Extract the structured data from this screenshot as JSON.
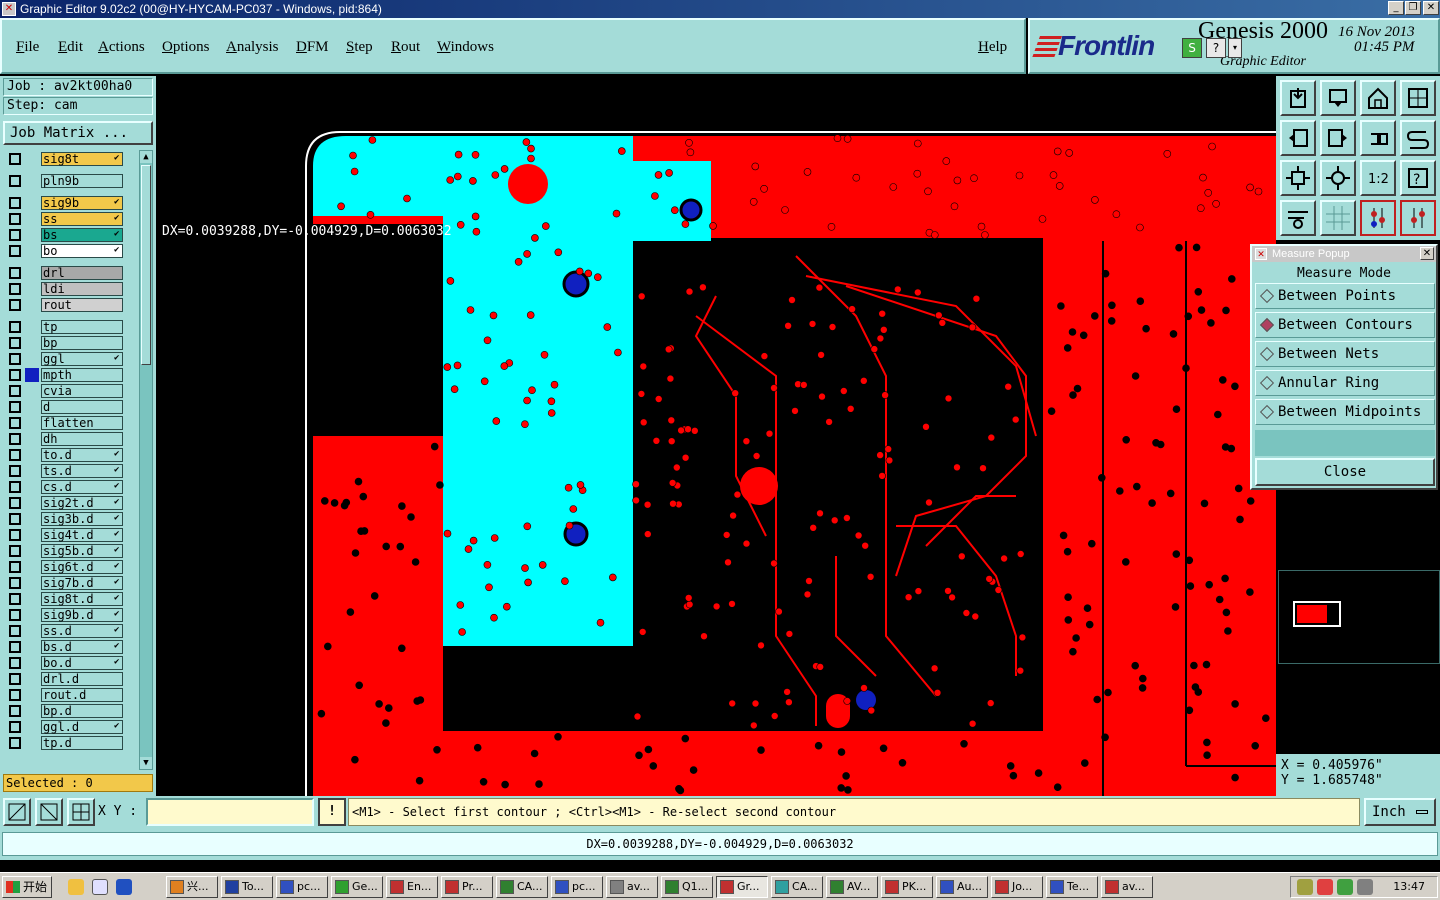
{
  "window": {
    "title": "Graphic Editor 9.02c2 (00@HY-HYCAM-PC037 - Windows, pid:864)"
  },
  "menubar": {
    "items": [
      "File",
      "Edit",
      "Actions",
      "Options",
      "Analysis",
      "DFM",
      "Step",
      "Rout",
      "Windows"
    ],
    "help": "Help"
  },
  "brand": {
    "logo": "Frontlin",
    "product": "Genesis 2000",
    "subtitle": "Graphic Editor",
    "date": "16 Nov 2013",
    "time": "01:45 PM"
  },
  "job": {
    "job_label": "Job : av2kt00ha0",
    "step_label": "Step: cam",
    "matrix_button": "Job Matrix ..."
  },
  "layers": [
    {
      "name": "sig8t",
      "color": "#f2c84a",
      "mark": "✔"
    },
    {
      "name": "pln9b",
      "color": "#a4dcd8",
      "mark": ""
    },
    {
      "name": "sig9b",
      "color": "#f2c84a",
      "mark": "✔"
    },
    {
      "name": "ss",
      "color": "#f2c84a",
      "mark": "✔"
    },
    {
      "name": "bs",
      "color": "#1aa890",
      "mark": "✔"
    },
    {
      "name": "bo",
      "color": "#ffffff",
      "mark": "✔"
    },
    {
      "name": "drl",
      "color": "#a8a8a8",
      "mark": ""
    },
    {
      "name": "ldi",
      "color": "#c0c0c0",
      "mark": ""
    },
    {
      "name": "rout",
      "color": "#d0d0d0",
      "mark": ""
    },
    {
      "name": "tp",
      "color": "#a4dcd8",
      "mark": ""
    },
    {
      "name": "bp",
      "color": "#a4dcd8",
      "mark": ""
    },
    {
      "name": "ggl",
      "color": "#a4dcd8",
      "mark": "✔"
    },
    {
      "name": "mpth",
      "color": "#a4dcd8",
      "mark": ""
    },
    {
      "name": "cvia",
      "color": "#a4dcd8",
      "mark": ""
    },
    {
      "name": "d",
      "color": "#a4dcd8",
      "mark": ""
    },
    {
      "name": "flatten",
      "color": "#a4dcd8",
      "mark": ""
    },
    {
      "name": "dh",
      "color": "#a4dcd8",
      "mark": ""
    },
    {
      "name": "to.d",
      "color": "#a4dcd8",
      "mark": "✔"
    },
    {
      "name": "ts.d",
      "color": "#a4dcd8",
      "mark": "✔"
    },
    {
      "name": "cs.d",
      "color": "#a4dcd8",
      "mark": "✔"
    },
    {
      "name": "sig2t.d",
      "color": "#a4dcd8",
      "mark": "✔"
    },
    {
      "name": "sig3b.d",
      "color": "#a4dcd8",
      "mark": "✔"
    },
    {
      "name": "sig4t.d",
      "color": "#a4dcd8",
      "mark": "✔"
    },
    {
      "name": "sig5b.d",
      "color": "#a4dcd8",
      "mark": "✔"
    },
    {
      "name": "sig6t.d",
      "color": "#a4dcd8",
      "mark": "✔"
    },
    {
      "name": "sig7b.d",
      "color": "#a4dcd8",
      "mark": "✔"
    },
    {
      "name": "sig8t.d",
      "color": "#a4dcd8",
      "mark": "✔"
    },
    {
      "name": "sig9b.d",
      "color": "#a4dcd8",
      "mark": "✔"
    },
    {
      "name": "ss.d",
      "color": "#a4dcd8",
      "mark": "✔"
    },
    {
      "name": "bs.d",
      "color": "#a4dcd8",
      "mark": "✔"
    },
    {
      "name": "bo.d",
      "color": "#a4dcd8",
      "mark": "✔"
    },
    {
      "name": "drl.d",
      "color": "#a4dcd8",
      "mark": ""
    },
    {
      "name": "rout.d",
      "color": "#a4dcd8",
      "mark": ""
    },
    {
      "name": "bp.d",
      "color": "#a4dcd8",
      "mark": ""
    },
    {
      "name": "ggl.d",
      "color": "#a4dcd8",
      "mark": "✔"
    },
    {
      "name": "tp.d",
      "color": "#a4dcd8",
      "mark": ""
    }
  ],
  "selected_label": "Selected : 0",
  "canvas": {
    "measure_readout": "DX=0.0039288,DY=-0.004929,D=0.0063032",
    "colors": {
      "copper": "#ff0000",
      "active": "#00ffff",
      "pad_blue": "#1020c0"
    }
  },
  "measure_popup": {
    "title": "Measure Popup",
    "mode_title": "Measure Mode",
    "options": [
      {
        "label": "Between Points",
        "selected": false
      },
      {
        "label": "Between Contours",
        "selected": true
      },
      {
        "label": "Between Nets",
        "selected": false
      },
      {
        "label": "Annular Ring",
        "selected": false
      },
      {
        "label": "Between Midpoints",
        "selected": false
      }
    ],
    "close_label": "Close"
  },
  "coords": {
    "x": "X = 0.405976\"",
    "y": "Y = 1.685748\""
  },
  "bottombar": {
    "xy_label": "X Y :",
    "xy_value": "",
    "help_glyph": "!",
    "prompt": "<M1> - Select first contour ; <Ctrl><M1> - Re-select second contour",
    "unit": "Inch"
  },
  "status": "DX=0.0039288,DY=-0.004929,D=0.0063032",
  "taskbar": {
    "start_label": "开始",
    "tasks": [
      {
        "label": "兴...",
        "active": false
      },
      {
        "label": "To...",
        "active": false
      },
      {
        "label": "pc...",
        "active": false
      },
      {
        "label": "Ge...",
        "active": false
      },
      {
        "label": "En...",
        "active": false
      },
      {
        "label": "Pr...",
        "active": false
      },
      {
        "label": "CA...",
        "active": false
      },
      {
        "label": "pc...",
        "active": false
      },
      {
        "label": "av...",
        "active": false
      },
      {
        "label": "Q1...",
        "active": false
      },
      {
        "label": "Gr...",
        "active": true
      },
      {
        "label": "CA...",
        "active": false
      },
      {
        "label": "AV...",
        "active": false
      },
      {
        "label": "PK...",
        "active": false
      },
      {
        "label": "Au...",
        "active": false
      },
      {
        "label": "Jo...",
        "active": false
      },
      {
        "label": "Te...",
        "active": false
      },
      {
        "label": "av...",
        "active": false
      }
    ],
    "clock": "13:47"
  }
}
